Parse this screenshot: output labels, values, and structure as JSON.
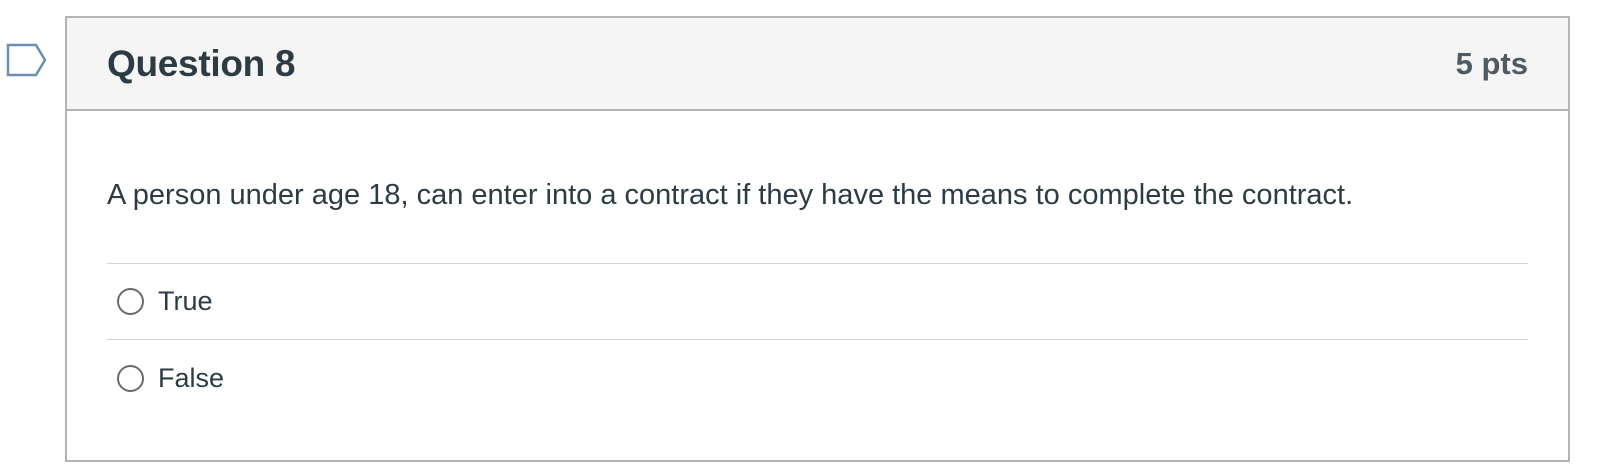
{
  "question": {
    "title": "Question 8",
    "points": "5 pts",
    "text": "A person under age 18, can enter into a contract if they have the means to complete the contract.",
    "flag_icon": "flag-icon",
    "answers": [
      {
        "label": "True",
        "selected": false
      },
      {
        "label": "False",
        "selected": false
      }
    ]
  },
  "colors": {
    "header_bg": "#f5f5f5",
    "border": "#b3b3b3",
    "text": "#2d3b45",
    "flag": "#6a8fae"
  }
}
